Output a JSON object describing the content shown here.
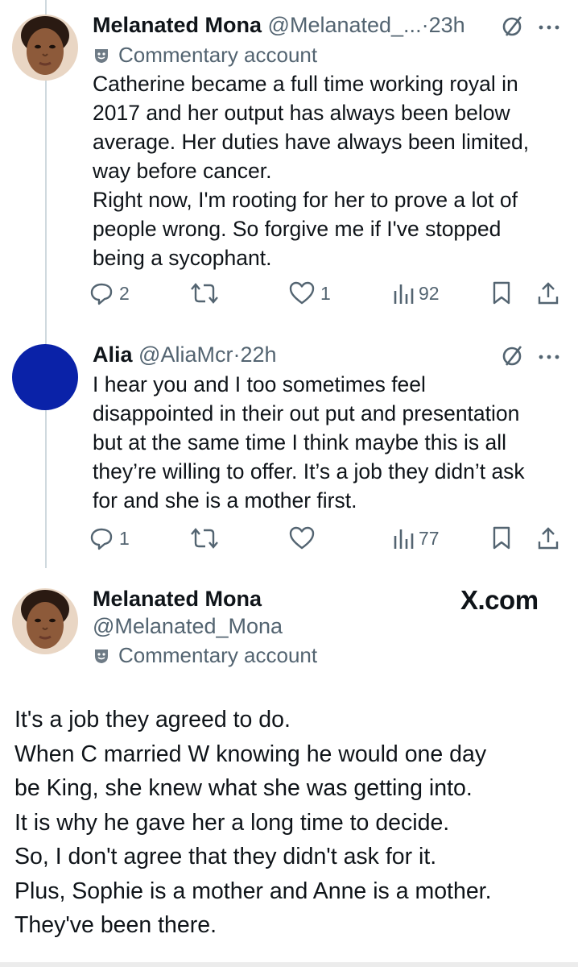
{
  "tweet1": {
    "name": "Melanated Mona",
    "handle": "@Melanated_...",
    "time": "·23h",
    "badge": "Commentary account",
    "lines": [
      "Catherine became a full time working royal in",
      "2017 and her output has always been below",
      "average. Her duties have always been limited,",
      "way before cancer.",
      "Right now, I'm rooting for her to prove a lot of",
      "people wrong. So forgive me if I've stopped",
      "being a sycophant."
    ],
    "replies": "2",
    "retweets": "",
    "likes": "1",
    "views": "92"
  },
  "tweet2": {
    "name": "Alia",
    "handle": "@AliaMcr",
    "time": "·22h",
    "lines": [
      "I hear you and I too sometimes feel",
      "disappointed in their out put and presentation",
      "but at the same time I think maybe this is all",
      "they’re willing to offer. It’s a job they didn’t ask",
      "for and she is a mother first."
    ],
    "replies": "1",
    "retweets": "",
    "likes": "",
    "views": "77",
    "avatar_color": "#0a22a8"
  },
  "tweet3": {
    "name": "Melanated Mona",
    "handle": "@Melanated_Mona",
    "badge": "Commentary account",
    "watermark": "X.com",
    "lines": [
      "It's a job they agreed to do.",
      "When C married W knowing he would one day",
      "be King, she knew what she was getting into.",
      "It is why he gave her a long time to decide.",
      "So, I don't agree that they didn't ask for it.",
      "Plus, Sophie is a mother and Anne is a mother.",
      "They've been there."
    ]
  },
  "icons": {
    "reply": "reply-icon",
    "retweet": "retweet-icon",
    "like": "heart-icon",
    "views": "views-icon",
    "bookmark": "bookmark-icon",
    "share": "share-icon",
    "more": "more-icon",
    "grok": "grok-icon",
    "badge": "commentary-badge-icon"
  },
  "colors": {
    "text": "#0f1419",
    "muted": "#536471",
    "thread_line": "#cfd9de"
  }
}
